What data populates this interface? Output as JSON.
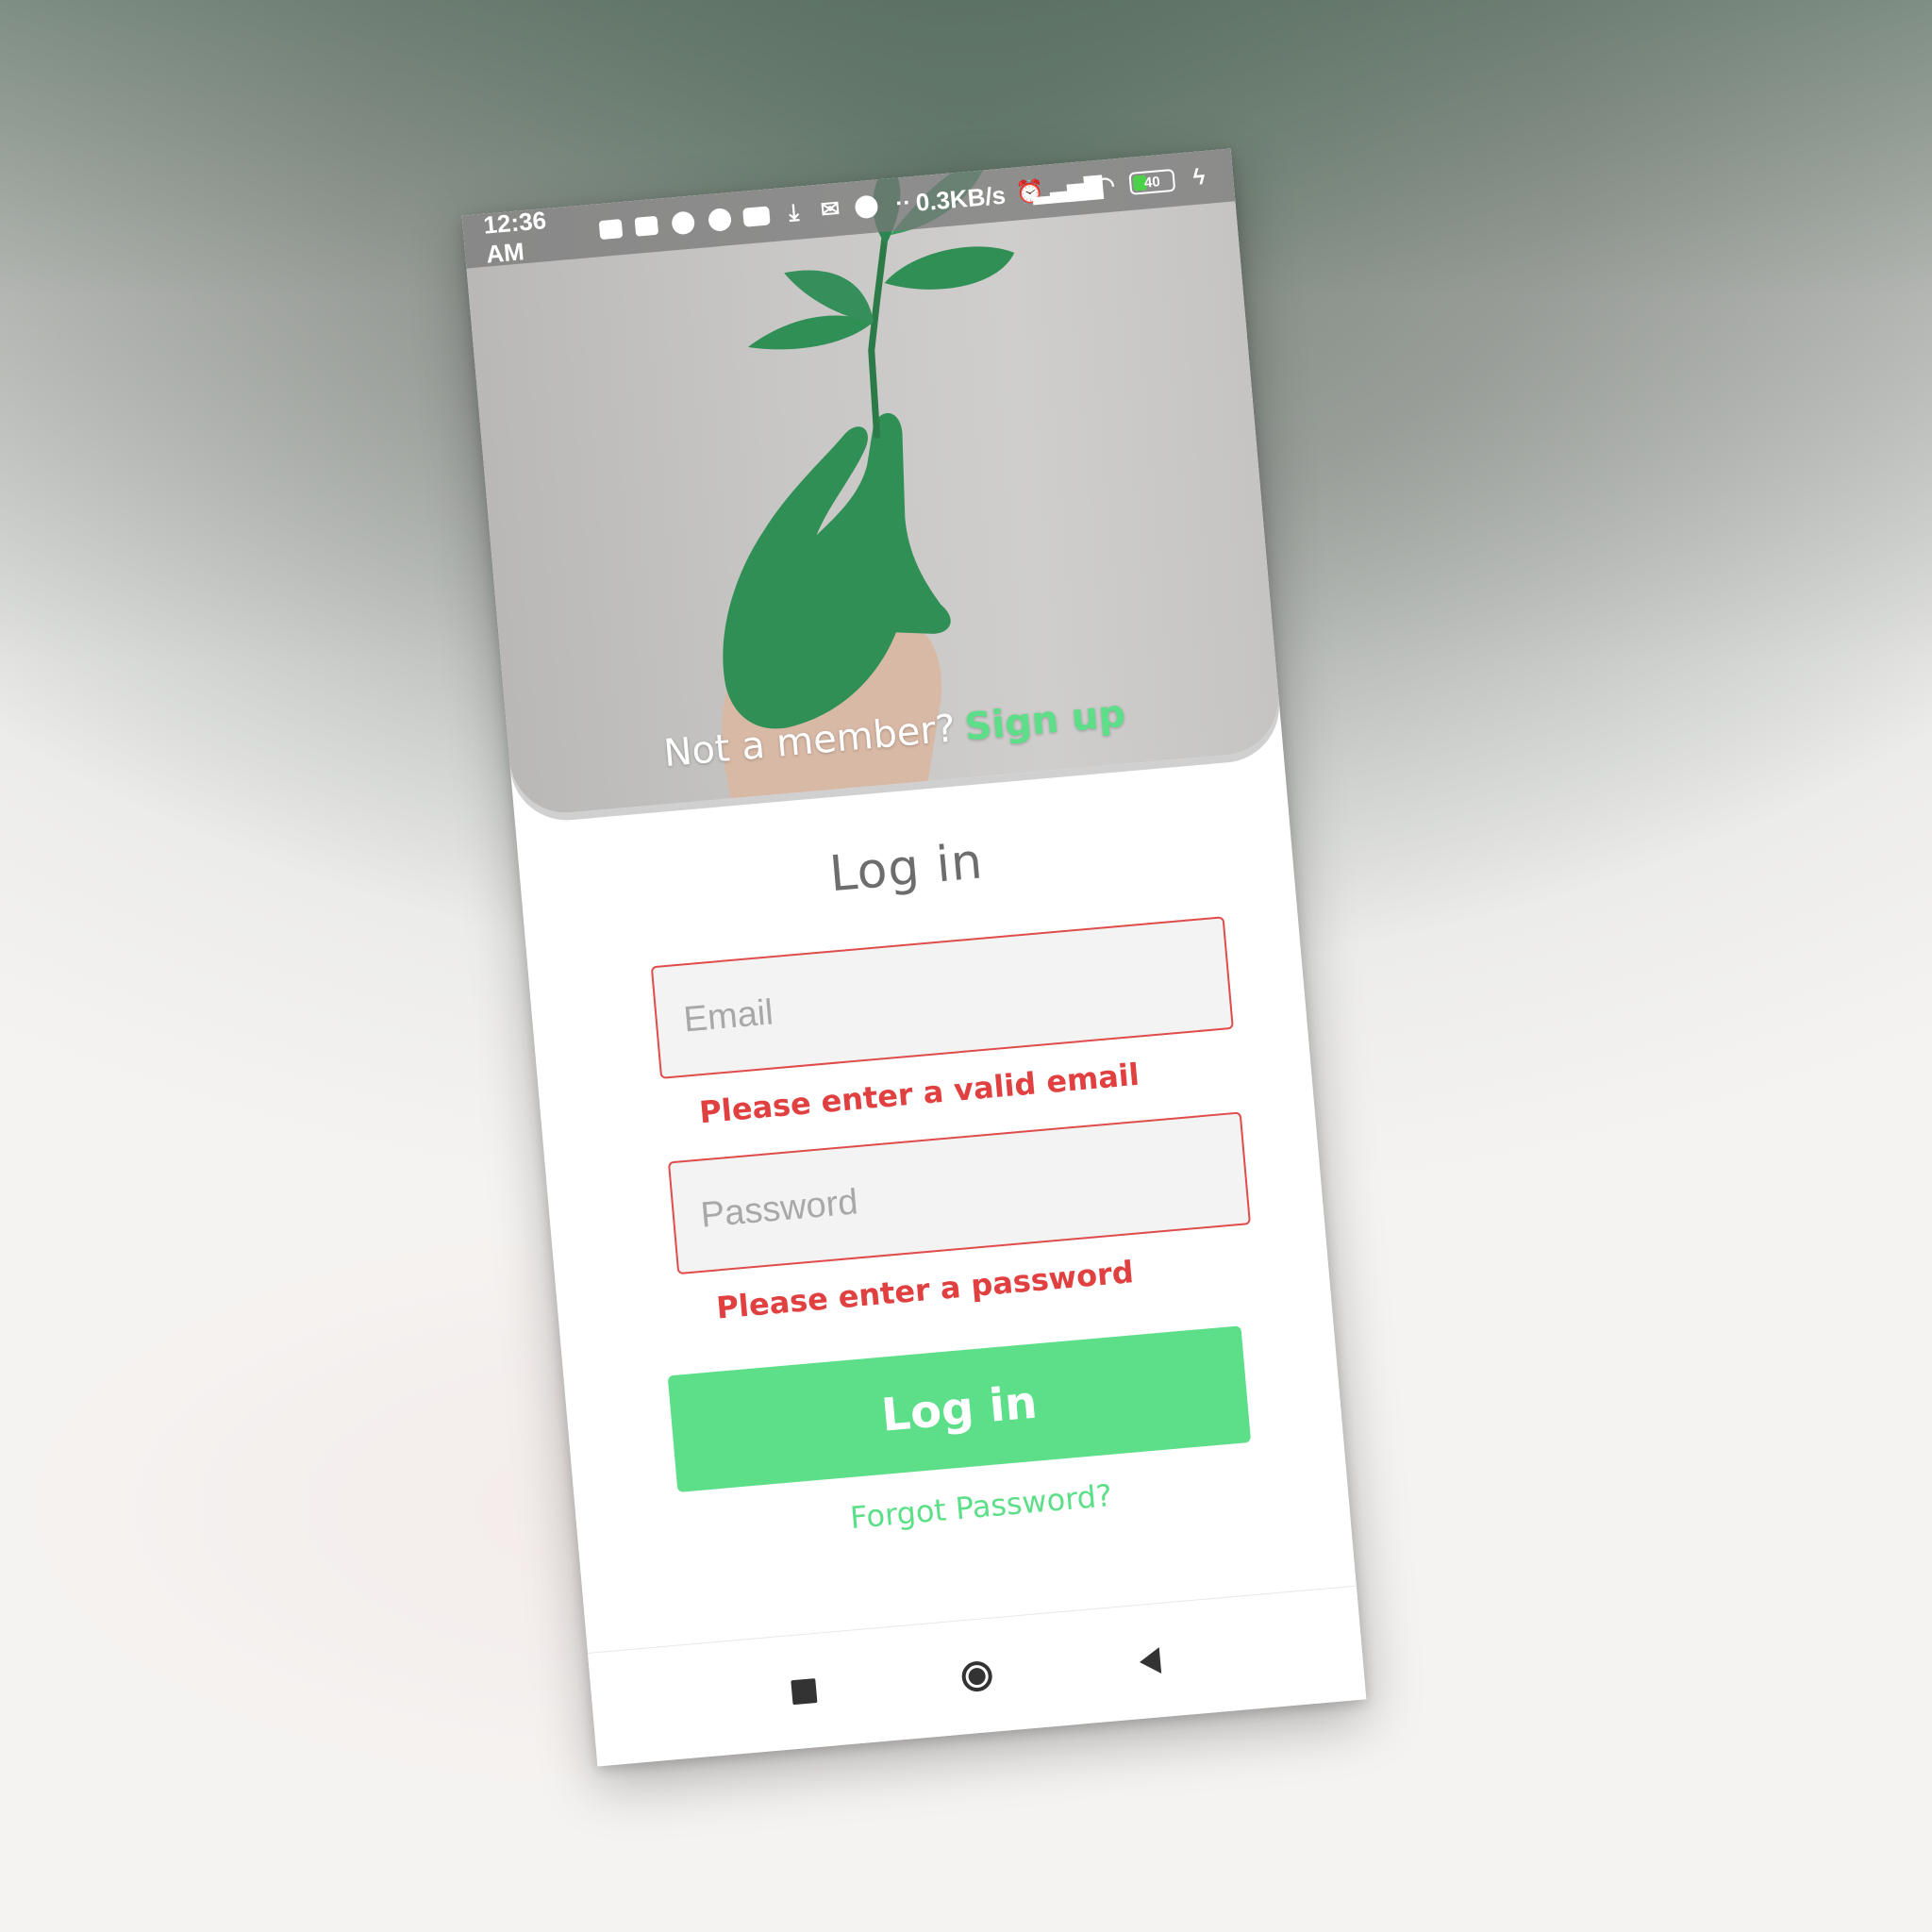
{
  "status_bar": {
    "time": "12:36 AM",
    "net_speed": "0.3KB/s",
    "battery_level": "40",
    "battery_fraction": 0.4,
    "notification_icons": [
      "message-icon",
      "message-icon",
      "messenger-icon",
      "messenger-icon",
      "youtube-icon",
      "download-icon",
      "gmail-icon",
      "whatsapp-icon",
      "more-dots-icon"
    ],
    "system_icons": [
      "alarm-icon",
      "signal-icon",
      "wifi-icon",
      "battery-icon",
      "charging-icon"
    ]
  },
  "hero": {
    "prompt": "Not a member?",
    "signup_label": "Sign up"
  },
  "login": {
    "title": "Log in",
    "email_placeholder": "Email",
    "email_value": "",
    "email_error": "Please enter a valid email",
    "password_placeholder": "Password",
    "password_value": "",
    "password_error": "Please enter a password",
    "submit_label": "Log in",
    "forgot_label": "Forgot Password?"
  },
  "colors": {
    "accent": "#5cdf88",
    "error": "#e04040",
    "field_bg": "#f3f3f3",
    "title": "#6d6d6d"
  },
  "nav_bar": {
    "buttons": [
      "recents-icon",
      "home-icon",
      "back-icon"
    ]
  }
}
